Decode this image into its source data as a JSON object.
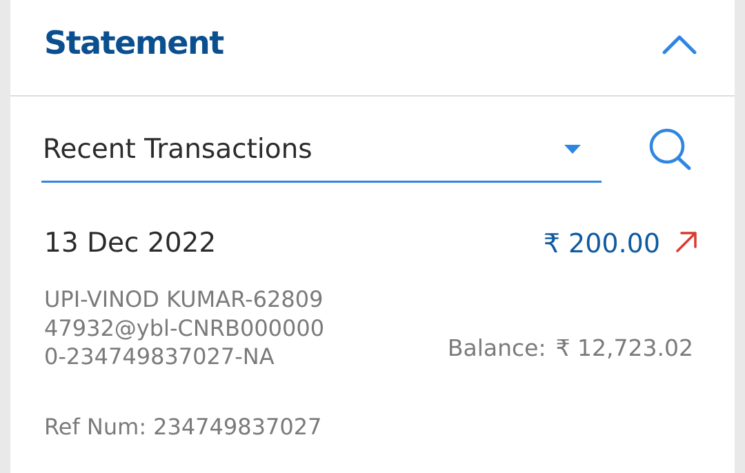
{
  "statement": {
    "title": "Statement",
    "collapse_icon": "chevron-up-icon"
  },
  "filter": {
    "selected": "Recent Transactions",
    "caret_icon": "caret-down-icon",
    "search_icon": "search-icon"
  },
  "transaction": {
    "date": "13 Dec 2022",
    "amount": "₹ 200.00",
    "direction_icon": "arrow-up-right-icon",
    "description": "UPI-VINOD KUMAR-6280947932@ybl-CNRB0000000-234749837027-NA",
    "balance_label": "Balance:",
    "balance_value": "₹ 12,723.02",
    "ref_label": "Ref Num:",
    "ref_value": "234749837027"
  },
  "colors": {
    "title": "#0b4f8f",
    "accent": "#2f86e0",
    "amount": "#0f5aa0",
    "debit_arrow": "#d93a2f",
    "muted_text": "#7a7a7a"
  }
}
